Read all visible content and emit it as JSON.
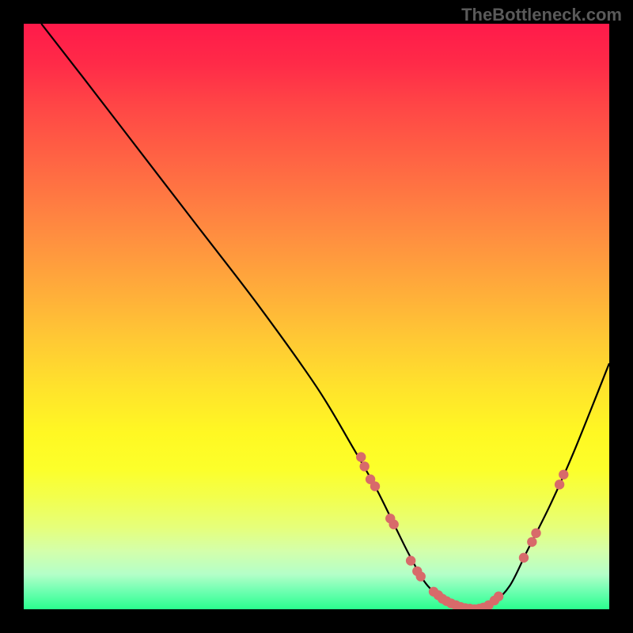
{
  "watermark": "TheBottleneck.com",
  "chart_data": {
    "type": "line",
    "title": "",
    "xlabel": "",
    "ylabel": "",
    "xlim": [
      0,
      100
    ],
    "ylim": [
      0,
      100
    ],
    "series": [
      {
        "name": "curve",
        "x": [
          3,
          10,
          20,
          30,
          40,
          50,
          56,
          60,
          63,
          66,
          69,
          73,
          77,
          80,
          83,
          86,
          90,
          94,
          100
        ],
        "y": [
          100,
          91,
          78,
          65,
          52,
          38,
          28,
          21,
          15,
          9,
          4,
          1,
          0,
          1,
          4,
          10,
          18,
          27,
          42
        ]
      }
    ],
    "markers": [
      {
        "x": 57.6,
        "y": 26.0
      },
      {
        "x": 58.2,
        "y": 24.4
      },
      {
        "x": 59.2,
        "y": 22.2
      },
      {
        "x": 60.0,
        "y": 21.0
      },
      {
        "x": 62.6,
        "y": 15.5
      },
      {
        "x": 63.2,
        "y": 14.5
      },
      {
        "x": 66.1,
        "y": 8.3
      },
      {
        "x": 67.2,
        "y": 6.5
      },
      {
        "x": 67.8,
        "y": 5.6
      },
      {
        "x": 70.0,
        "y": 3.0
      },
      {
        "x": 70.8,
        "y": 2.4
      },
      {
        "x": 71.5,
        "y": 1.8
      },
      {
        "x": 72.2,
        "y": 1.4
      },
      {
        "x": 73.0,
        "y": 1.0
      },
      {
        "x": 73.8,
        "y": 0.7
      },
      {
        "x": 74.6,
        "y": 0.4
      },
      {
        "x": 75.4,
        "y": 0.2
      },
      {
        "x": 76.2,
        "y": 0.1
      },
      {
        "x": 77.0,
        "y": 0.0
      },
      {
        "x": 77.8,
        "y": 0.1
      },
      {
        "x": 78.5,
        "y": 0.3
      },
      {
        "x": 79.4,
        "y": 0.7
      },
      {
        "x": 80.4,
        "y": 1.5
      },
      {
        "x": 81.1,
        "y": 2.2
      },
      {
        "x": 85.4,
        "y": 8.8
      },
      {
        "x": 86.8,
        "y": 11.5
      },
      {
        "x": 87.5,
        "y": 13.0
      },
      {
        "x": 91.5,
        "y": 21.3
      },
      {
        "x": 92.2,
        "y": 23.0
      }
    ],
    "gradient_bands": [
      {
        "pos": 0,
        "color": "#ff1a4a"
      },
      {
        "pos": 50,
        "color": "#ffc23a"
      },
      {
        "pos": 75,
        "color": "#fff823"
      },
      {
        "pos": 100,
        "color": "#2aff8e"
      }
    ]
  }
}
